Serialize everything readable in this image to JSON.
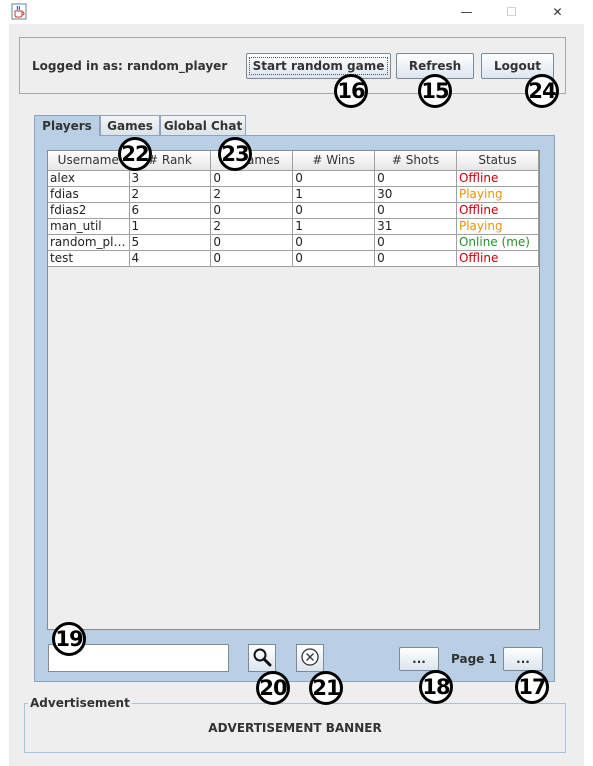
{
  "window": {
    "app_icon": "java-cup-icon",
    "minimize_glyph": "—",
    "maximize_glyph": "☐",
    "close_glyph": "✕"
  },
  "header": {
    "logged_in_label": "Logged in as: random_player",
    "start_random_game_label": "Start random game",
    "refresh_label": "Refresh",
    "logout_label": "Logout"
  },
  "tabs": [
    {
      "label": "Players",
      "active": true
    },
    {
      "label": "Games",
      "active": false
    },
    {
      "label": "Global Chat",
      "active": false
    }
  ],
  "players_table": {
    "columns": [
      "Username",
      "# Rank",
      "# Games",
      "# Wins",
      "# Shots",
      "Status"
    ],
    "rows": [
      {
        "username": "alex",
        "rank": "3",
        "games": "0",
        "wins": "0",
        "shots": "0",
        "status": "Offline",
        "status_color": "#cc0000"
      },
      {
        "username": "fdias",
        "rank": "2",
        "games": "2",
        "wins": "1",
        "shots": "30",
        "status": "Playing",
        "status_color": "#e69500"
      },
      {
        "username": "fdias2",
        "rank": "6",
        "games": "0",
        "wins": "0",
        "shots": "0",
        "status": "Offline",
        "status_color": "#cc0000"
      },
      {
        "username": "man_util",
        "rank": "1",
        "games": "2",
        "wins": "1",
        "shots": "31",
        "status": "Playing",
        "status_color": "#e69500"
      },
      {
        "username": "random_pla...",
        "rank": "5",
        "games": "0",
        "wins": "0",
        "shots": "0",
        "status": "Online (me)",
        "status_color": "#2a8f2a"
      },
      {
        "username": "test",
        "rank": "4",
        "games": "0",
        "wins": "0",
        "shots": "0",
        "status": "Offline",
        "status_color": "#cc0000"
      }
    ]
  },
  "footer_controls": {
    "search_value": "",
    "search_icon": "magnifier-icon",
    "clear_icon": "circled-x-icon",
    "prev_label": "...",
    "page_label": "Page 1",
    "next_label": "..."
  },
  "advertisement": {
    "legend": "Advertisement",
    "banner": "ADVERTISEMENT BANNER"
  },
  "annotations": [
    "16",
    "15",
    "24",
    "22",
    "23",
    "19",
    "20",
    "21",
    "18",
    "17"
  ]
}
